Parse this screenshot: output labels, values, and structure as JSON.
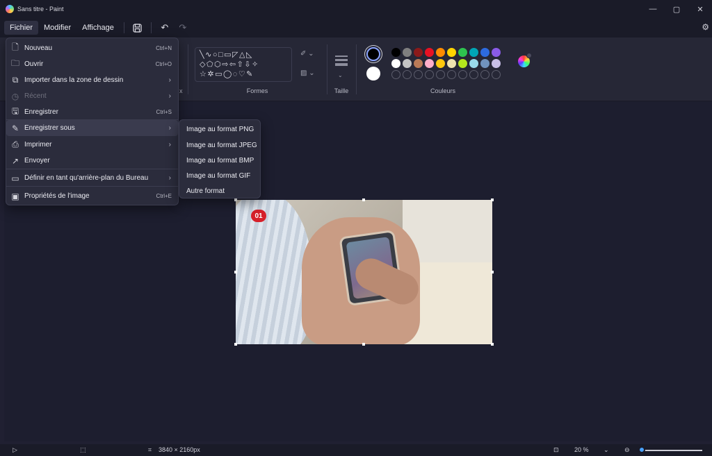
{
  "window": {
    "title": "Sans titre - Paint",
    "controls": {
      "minimize": "—",
      "maximize": "▢",
      "close": "✕"
    }
  },
  "menubar": {
    "items": [
      "Fichier",
      "Modifier",
      "Affichage"
    ],
    "active": "Fichier"
  },
  "ribbon": {
    "groups": {
      "formes": "Formes",
      "taille": "Taille",
      "couleurs": "Couleurs"
    },
    "partial_label": "x",
    "shapes_rows": [
      "╲∿○□▭◸△◺",
      "◇⬠⬡⇨⇦⇧⇩✧",
      "☆✲▭◯◌♡✎"
    ],
    "palette": {
      "primary": "#000000",
      "secondary": "#ffffff",
      "row1": [
        "#000000",
        "#7f7f7f",
        "#8b1a1a",
        "#e81123",
        "#ff8c00",
        "#ffd400",
        "#2ec44f",
        "#00a6b6",
        "#2d6be0",
        "#8a5be8"
      ],
      "row2": [
        "#ffffff",
        "#c3c3c3",
        "#b97a57",
        "#ffaec9",
        "#ffc90e",
        "#efe4b0",
        "#b5e61d",
        "#99d9ea",
        "#7092be",
        "#c8bfe7"
      ]
    }
  },
  "file_menu": {
    "items": [
      {
        "label": "Nouveau",
        "shortcut": "Ctrl+N",
        "icon": "new-file-icon"
      },
      {
        "label": "Ouvrir",
        "shortcut": "Ctrl+O",
        "icon": "folder-icon"
      },
      {
        "label": "Importer dans la zone de dessin",
        "submenu": true,
        "icon": "import-icon"
      },
      {
        "label": "Récent",
        "submenu": true,
        "disabled": true,
        "icon": "recent-icon"
      },
      {
        "label": "Enregistrer",
        "shortcut": "Ctrl+S",
        "icon": "save-icon"
      },
      {
        "label": "Enregistrer sous",
        "submenu": true,
        "highlight": true,
        "icon": "save-as-icon"
      },
      {
        "label": "Imprimer",
        "submenu": true,
        "icon": "print-icon"
      },
      {
        "label": "Envoyer",
        "icon": "share-icon"
      },
      {
        "label": "Définir en tant qu'arrière-plan du Bureau",
        "submenu": true,
        "icon": "wallpaper-icon"
      },
      {
        "label": "Propriétés de l'image",
        "shortcut": "Ctrl+E",
        "icon": "image-properties-icon"
      }
    ]
  },
  "save_as_submenu": {
    "items": [
      "Image au format PNG",
      "Image au format JPEG",
      "Image au format BMP",
      "Image au format GIF",
      "Autre format"
    ]
  },
  "canvas": {
    "badge": "01"
  },
  "statusbar": {
    "dimensions": "3840 × 2160px",
    "zoom": "20 %",
    "zoom_fraction": 0.0
  }
}
